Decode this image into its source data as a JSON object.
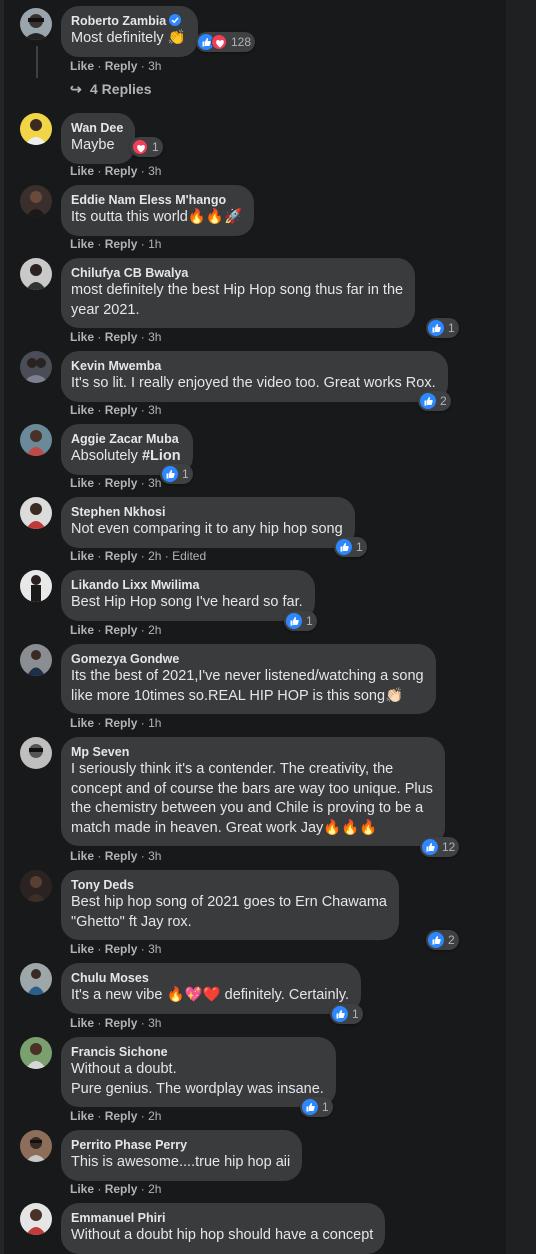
{
  "labels": {
    "like": "Like",
    "reply": "Reply",
    "dot": "·"
  },
  "replies": {
    "label": "4 Replies"
  },
  "comments": [
    {
      "name": "Roberto Zambia",
      "text": "Most definitely 👏",
      "time": "3h",
      "reactions": {
        "count": "128",
        "types": [
          "like",
          "love"
        ]
      }
    },
    {
      "name": "Wan Dee",
      "text": "Maybe",
      "time": "3h",
      "reactions": {
        "count": "1",
        "types": [
          "love"
        ]
      }
    },
    {
      "name": "Eddie Nam Eless M'hango",
      "text": "Its outta this world🔥🔥🚀",
      "time": "1h"
    },
    {
      "name": "Chilufya CB Bwalya",
      "text_lines": [
        "most definitely the best Hip Hop song thus far in the",
        "year 2021."
      ],
      "time": "3h",
      "reactions": {
        "count": "1",
        "types": [
          "like"
        ]
      }
    },
    {
      "name": "Kevin Mwemba",
      "text": "It's so lit. I really enjoyed the video too. Great works Rox.",
      "time": "3h",
      "reactions": {
        "count": "2",
        "types": [
          "like"
        ]
      }
    },
    {
      "name": "Aggie Zacar Muba",
      "text_prefix": "Absolutely ",
      "text_bold": "#Lion",
      "time": "3h",
      "reactions": {
        "count": "1",
        "types": [
          "like"
        ]
      }
    },
    {
      "name": "Stephen Nkhosi",
      "text": "Not even comparing it to any hip hop song",
      "time": "2h",
      "edited": "Edited",
      "reactions": {
        "count": "1",
        "types": [
          "like"
        ]
      }
    },
    {
      "name": "Likando Lixx Mwilima",
      "text": "Best Hip Hop song I've heard so far.",
      "time": "2h",
      "reactions": {
        "count": "1",
        "types": [
          "like"
        ]
      }
    },
    {
      "name": "Gomezya Gondwe",
      "text_lines": [
        "Its the best of 2021,I've never listened/watching a song",
        "like more 10times so.REAL HIP HOP is this song👏🏻"
      ],
      "time": "1h"
    },
    {
      "name": "Mp Seven",
      "text_lines": [
        "I seriously think it's a contender. The creativity, the",
        "concept and of course the bars are way too unique. Plus",
        "the chemistry between you and Chile is proving to be a",
        "match made in heaven. Great work Jay🔥🔥🔥"
      ],
      "time": "3h",
      "reactions": {
        "count": "12",
        "types": [
          "like"
        ]
      }
    },
    {
      "name": "Tony Deds",
      "text_lines": [
        "Best hip hop song of 2021 goes to Ern Chawama",
        "\"Ghetto\" ft Jay rox."
      ],
      "time": "3h",
      "reactions": {
        "count": "2",
        "types": [
          "like"
        ]
      }
    },
    {
      "name": "Chulu Moses",
      "text": "It's a new vibe 🔥💖❤️ definitely. Certainly.",
      "time": "3h",
      "reactions": {
        "count": "1",
        "types": [
          "like"
        ]
      }
    },
    {
      "name": "Francis Sichone",
      "text_lines": [
        "Without a doubt.",
        "Pure genius. The wordplay was insane."
      ],
      "time": "2h",
      "reactions": {
        "count": "1",
        "types": [
          "like"
        ]
      }
    },
    {
      "name": "Perrito Phase Perry",
      "text": "This is awesome....true hip hop aii",
      "time": "2h"
    },
    {
      "name": "Emmanuel Phiri",
      "text": "Without a doubt hip hop should have a concept"
    }
  ],
  "colors": {
    "background": "#18191a",
    "bubble": "#3a3b3c",
    "like": "#2d88ff",
    "love": "#f33e58",
    "muted": "#b0b3b8"
  },
  "icons": [
    "like-icon",
    "love-icon",
    "verified-icon",
    "reply-arrow-icon"
  ]
}
